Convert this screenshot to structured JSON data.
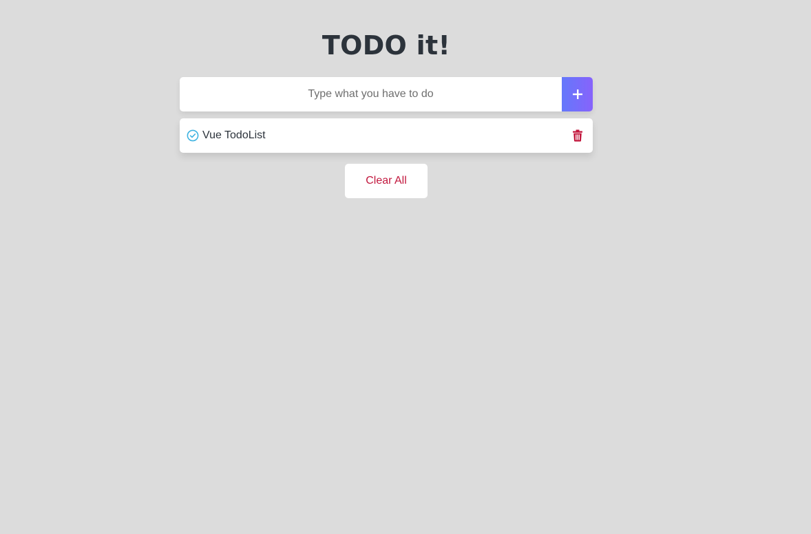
{
  "header": {
    "title": "TODO it!"
  },
  "input": {
    "placeholder": "Type what you have to do",
    "value": "",
    "add_button_icon": "plus-icon"
  },
  "todos": [
    {
      "text": "Vue TodoList",
      "completed": false,
      "check_icon": "check-circle-icon",
      "delete_icon": "trash-icon"
    }
  ],
  "footer": {
    "clear_label": "Clear All"
  },
  "colors": {
    "background": "#dcdcdc",
    "title": "#2c333b",
    "accent_gradient_start": "#6478fb",
    "accent_gradient_end": "#8763fb",
    "check": "#3eb3e1",
    "danger": "#c2173d"
  }
}
